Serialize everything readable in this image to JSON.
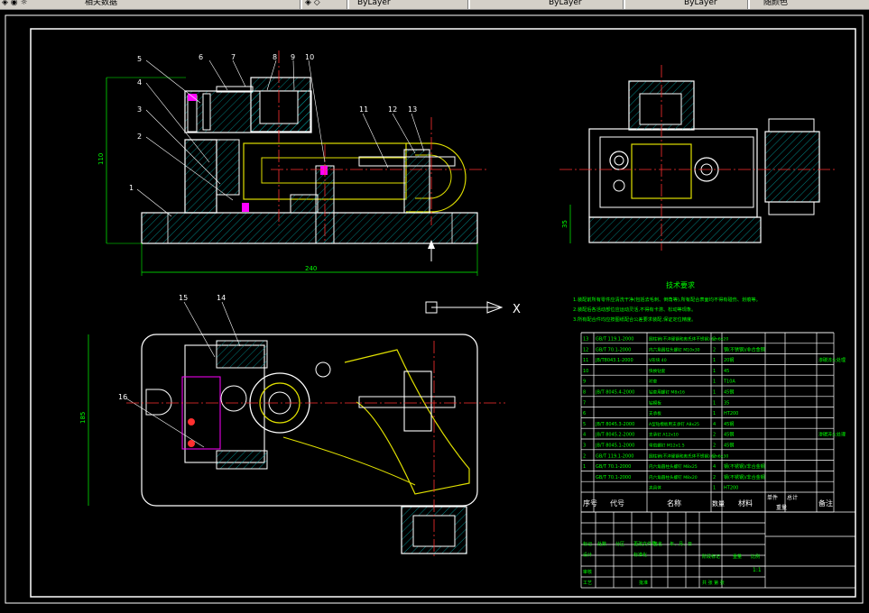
{
  "toolbar": {
    "layer_combo": "相关数据",
    "style_combo_1": "ByLayer",
    "style_combo_2": "ByLayer",
    "style_combo_3": "ByLayer",
    "plot_combo": "随颜色"
  },
  "drawing": {
    "balloons": [
      "1",
      "2",
      "3",
      "4",
      "5",
      "6",
      "7",
      "8",
      "9",
      "10",
      "11",
      "12",
      "13",
      "14",
      "15",
      "16"
    ],
    "dim_height": "110",
    "dim_width": "240",
    "dim_right": "35",
    "dim_plan": "185",
    "tech_title": "技术要求",
    "tech_lines": [
      "1.装配前所有零件应清洗干净(包括去毛刺、倒角等),所有配合表面均不得有碰伤、划痕等。",
      "2.装配后各活动部位应运动灵活,不得有卡滞、松动等现象。",
      "3.所有配合件均应按图纸配合公差要求装配,保证定位精度。"
    ],
    "ucs_x": "X"
  },
  "bom": {
    "header": [
      "序号",
      "代号",
      "名称",
      "数量",
      "材料",
      "单件",
      "总计",
      "备注"
    ],
    "weight_label": "重量",
    "rows": [
      [
        "13",
        "GB/T 119.1-2000",
        "圆柱销(不淬硬钢和奥氏体不锈钢) 6m6x20",
        "2",
        "",
        "",
        "",
        ""
      ],
      [
        "12",
        "GB/T 70.1-2000",
        "内六角圆柱头螺钉 M10x30",
        "2",
        "钢(不锈钢)/非合金钢",
        "",
        "",
        ""
      ],
      [
        "11",
        "JB/T8043.1-2000",
        "V形块 40",
        "1",
        "20钢",
        "",
        "",
        "渗碳淬火处理"
      ],
      [
        "10",
        "",
        "快换钻套",
        "1",
        "45",
        "",
        "",
        ""
      ],
      [
        "9",
        "",
        "衬套",
        "1",
        "T10A",
        "",
        "",
        ""
      ],
      [
        "8",
        "JB/T 8045.4-2000",
        "钻套用螺钉 M8x16",
        "1",
        "45钢",
        "",
        "",
        ""
      ],
      [
        "7",
        "",
        "钻模板",
        "1",
        "35",
        "",
        "",
        ""
      ],
      [
        "6",
        "",
        "支承板",
        "1",
        "HT200",
        "",
        "",
        ""
      ],
      [
        "5",
        "JB/T 8045.3-2000",
        "A型钻模板用支承钉 A8x25",
        "4",
        "45钢",
        "",
        "",
        ""
      ],
      [
        "4",
        "JB/T 8045.2-2000",
        "支承钉 A12x10",
        "2",
        "45钢",
        "",
        "",
        "渗碳淬火处理"
      ],
      [
        "3",
        "JB/T 8045.1-2000",
        "带肩螺钉 M12x1.5",
        "2",
        "45钢",
        "",
        "",
        ""
      ],
      [
        "2",
        "GB/T 119.1-2000",
        "圆柱销(不淬硬钢和奥氏体不锈钢) 6m6x30",
        "2",
        "",
        "",
        "",
        ""
      ],
      [
        "1",
        "GB/T 70.1-2000",
        "内六角圆柱头螺钉 M8x25",
        "4",
        "钢(不锈钢)/非合金钢",
        "",
        "",
        ""
      ],
      [
        "",
        "GB/T 70.1-2000",
        "内六角圆柱头螺钉 M8x20",
        "2",
        "钢(不锈钢)/非合金钢",
        "",
        "",
        ""
      ],
      [
        "",
        "",
        "夹具体",
        "1",
        "HT200",
        "",
        "",
        ""
      ]
    ]
  },
  "title_block": {
    "row1": [
      "标记",
      "处数",
      "分区",
      "更改文件号",
      "签名",
      "年、月、日"
    ],
    "row2": [
      "设计",
      "",
      "",
      "标准化"
    ],
    "stage_label": "阶段标记",
    "weight_label": "重量",
    "ratio_label": "比例",
    "ratio": "1:1",
    "check_label": "审核",
    "process_label": "工艺",
    "approve_label": "批准",
    "sheet_label": "共 张 第 张"
  }
}
